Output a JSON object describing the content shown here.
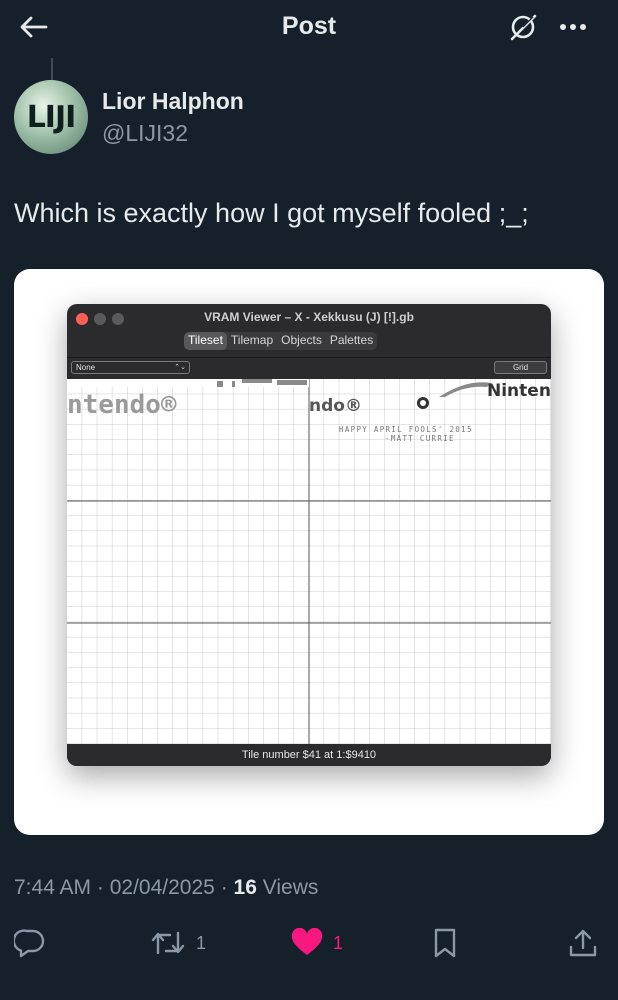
{
  "header": {
    "title": "Post"
  },
  "author": {
    "name": "Lior Halphon",
    "handle": "@LIJI32",
    "avatar_text": "LIJI"
  },
  "tweet": {
    "text": "Which is exactly how I got myself fooled ;_;"
  },
  "vram_window": {
    "title": "VRAM Viewer – X - Xekkusu (J) [!].gb",
    "tabs": [
      "Tileset",
      "Tilemap",
      "Objects",
      "Palettes"
    ],
    "selected_tab": "Tileset",
    "palette_select": "None",
    "grid_button": "Grid",
    "status": "Tile number $41 at 1:$9410",
    "tile_text": {
      "line1": "HAPPY APRIL FOOLS' 2015",
      "line2": "-MATT CURRIE",
      "frag_left": "ntendo®",
      "frag_mid": "ndo®",
      "frag_right": "Ninten"
    }
  },
  "footer": {
    "time": "7:44 AM",
    "date": "02/04/2025",
    "views_count": "16",
    "views_label": "Views",
    "reply_count": "",
    "retweet_count": "1",
    "like_count": "1"
  },
  "colors": {
    "background": "#15202b",
    "muted": "#8b98a5",
    "like": "#f91880",
    "text": "#e7e9ea"
  }
}
